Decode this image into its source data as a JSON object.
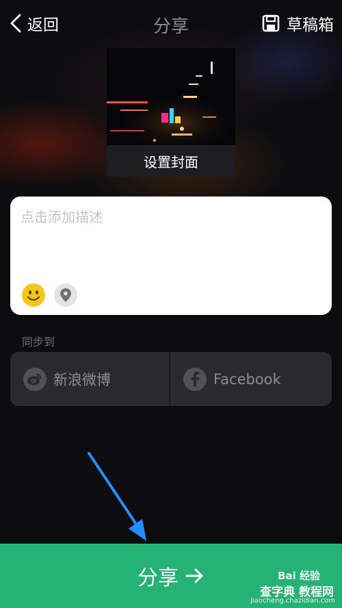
{
  "header": {
    "back_label": "返回",
    "title": "分享",
    "drafts_label": "草稿箱"
  },
  "cover": {
    "label": "设置封面"
  },
  "description": {
    "placeholder": "点击添加描述",
    "value": ""
  },
  "sync": {
    "label": "同步到",
    "options": [
      {
        "label": "新浪微博",
        "icon": "weibo-icon"
      },
      {
        "label": "Facebook",
        "icon": "facebook-icon"
      }
    ]
  },
  "share_button": {
    "label": "分享"
  },
  "watermark": {
    "brand": "Bai 经验",
    "site": "查字典 教程网",
    "url": "jiaocheng.chazidian.com"
  },
  "colors": {
    "accent_green": "#25b275",
    "arrow_blue": "#1e90ff",
    "emoji_yellow": "#f5c518"
  }
}
